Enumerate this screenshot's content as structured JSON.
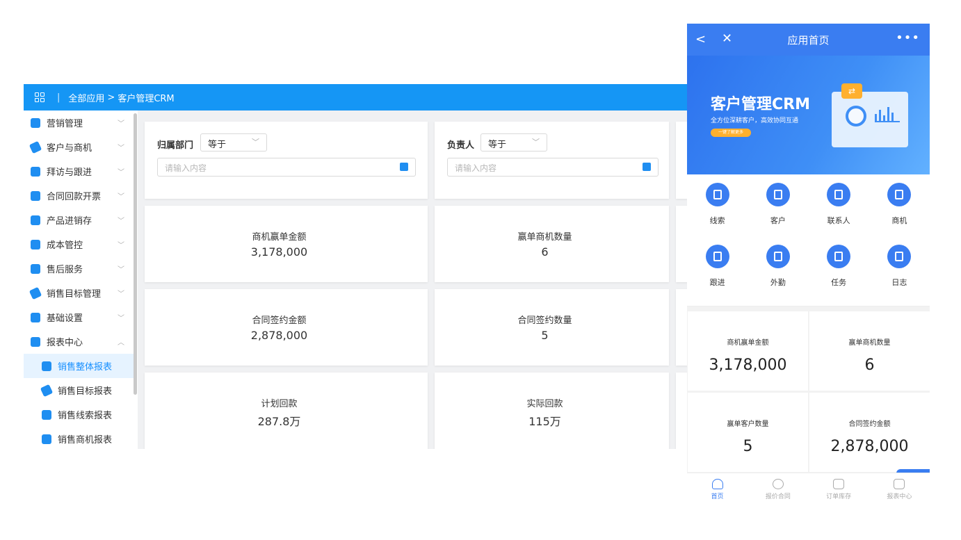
{
  "desktop": {
    "breadcrumb": {
      "all_apps": "全部应用",
      "arrow": ">",
      "current": "客户管理CRM",
      "sep": "|"
    },
    "sidebar": {
      "items": [
        {
          "label": "营销管理",
          "icon": "mail-icon"
        },
        {
          "label": "客户与商机",
          "icon": "send-icon"
        },
        {
          "label": "拜访与跟进",
          "icon": "visitor-icon"
        },
        {
          "label": "合同回款开票",
          "icon": "coins-icon"
        },
        {
          "label": "产品进销存",
          "icon": "cart-icon"
        },
        {
          "label": "成本管控",
          "icon": "wallet-icon"
        },
        {
          "label": "售后服务",
          "icon": "user-icon"
        },
        {
          "label": "销售目标管理",
          "icon": "send-icon"
        },
        {
          "label": "基础设置",
          "icon": "grid-icon"
        },
        {
          "label": "报表中心",
          "icon": "pie-icon"
        }
      ],
      "sub_items": [
        {
          "label": "销售整体报表",
          "icon": "ticket-icon"
        },
        {
          "label": "销售目标报表",
          "icon": "send-icon"
        },
        {
          "label": "销售线索报表",
          "icon": "lead-icon"
        },
        {
          "label": "销售商机报表",
          "icon": "yen-icon"
        }
      ]
    },
    "filters": [
      {
        "label": "归属部门",
        "operator": "等于",
        "placeholder": "请输入内容"
      },
      {
        "label": "负责人",
        "operator": "等于",
        "placeholder": "请输入内容"
      }
    ],
    "metrics": [
      {
        "title": "商机赢单金额",
        "value": "3,178,000"
      },
      {
        "title": "赢单商机数量",
        "value": "6"
      },
      {
        "title": "合同签约金额",
        "value": "2,878,000"
      },
      {
        "title": "合同签约数量",
        "value": "5"
      },
      {
        "title": "计划回款",
        "value": "287.8万"
      },
      {
        "title": "实际回款",
        "value": "115万"
      }
    ]
  },
  "mobile": {
    "title": "应用首页",
    "back": "<",
    "close": "✕",
    "more": "•••",
    "banner": {
      "title": "客户管理CRM",
      "subtitle": "全方位深耕客户，高效协同互通",
      "button": "一键了解更多"
    },
    "apps": [
      "线索",
      "客户",
      "联系人",
      "商机",
      "跟进",
      "外勤",
      "任务",
      "日志"
    ],
    "stats": [
      {
        "title": "商机赢单金额",
        "value": "3,178,000"
      },
      {
        "title": "赢单商机数量",
        "value": "6"
      },
      {
        "title": "赢单客户数量",
        "value": "5"
      },
      {
        "title": "合同签约金额",
        "value": "2,878,000"
      }
    ],
    "tabs": [
      "首页",
      "报价合同",
      "订单库存",
      "报表中心"
    ]
  },
  "colors": {
    "accent": "#1596f5",
    "mobile_accent": "#3a7df1",
    "active_bg": "#e6f3ff"
  }
}
